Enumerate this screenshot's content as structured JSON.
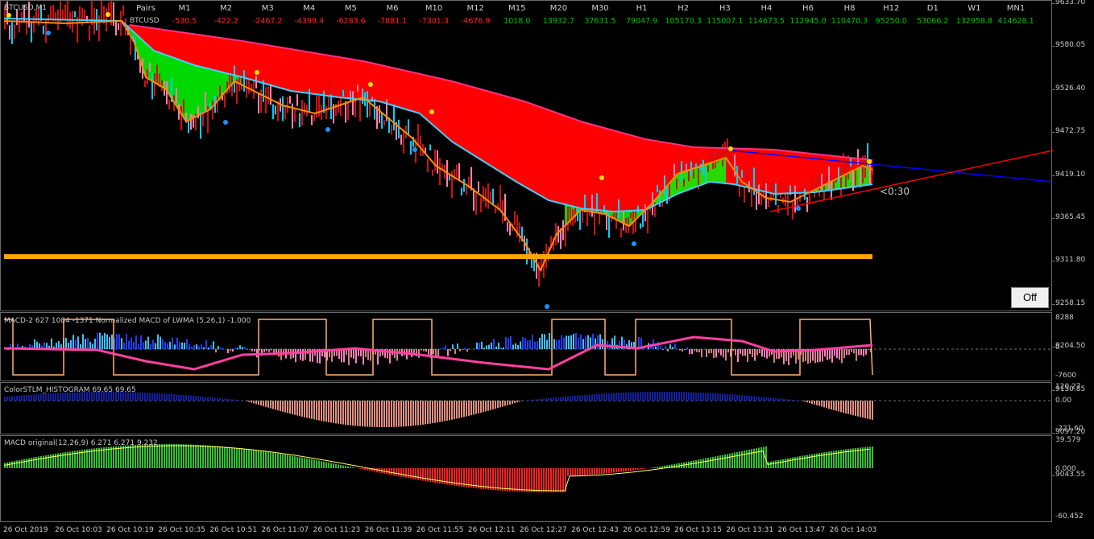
{
  "symbol_label": "BTCUSD,M1",
  "pair_name": "BTCUSD",
  "pairs_header": "Pairs",
  "timeframes": [
    {
      "name": "M1",
      "value": "-530.5",
      "sign": "neg"
    },
    {
      "name": "M2",
      "value": "-422.2",
      "sign": "neg"
    },
    {
      "name": "M3",
      "value": "-2467.2",
      "sign": "neg"
    },
    {
      "name": "M4",
      "value": "-4399.4",
      "sign": "neg"
    },
    {
      "name": "M5",
      "value": "-6283.6",
      "sign": "neg"
    },
    {
      "name": "M6",
      "value": "-7881.1",
      "sign": "neg"
    },
    {
      "name": "M10",
      "value": "-7301.3",
      "sign": "neg"
    },
    {
      "name": "M12",
      "value": "-4676.9",
      "sign": "neg"
    },
    {
      "name": "M15",
      "value": "1018.0",
      "sign": "pos"
    },
    {
      "name": "M20",
      "value": "13932.7",
      "sign": "pos"
    },
    {
      "name": "M30",
      "value": "37631.5",
      "sign": "pos"
    },
    {
      "name": "H1",
      "value": "79047.9",
      "sign": "pos"
    },
    {
      "name": "H2",
      "value": "105170.3",
      "sign": "pos"
    },
    {
      "name": "H3",
      "value": "115007.1",
      "sign": "pos"
    },
    {
      "name": "H4",
      "value": "114673.5",
      "sign": "pos"
    },
    {
      "name": "H6",
      "value": "112945.0",
      "sign": "pos"
    },
    {
      "name": "H8",
      "value": "110470.3",
      "sign": "pos"
    },
    {
      "name": "H12",
      "value": "95250.0",
      "sign": "pos"
    },
    {
      "name": "D1",
      "value": "53066.2",
      "sign": "pos"
    },
    {
      "name": "W1",
      "value": "132958.8",
      "sign": "pos"
    },
    {
      "name": "MN1",
      "value": "414628.1",
      "sign": "pos"
    }
  ],
  "price_axis": [
    "9633.70",
    "9580.05",
    "9526.40",
    "9472.75",
    "9419.10",
    "9365.45",
    "9311.80",
    "9258.15",
    "9204.50",
    "9150.85",
    "9097.20",
    "9043.55"
  ],
  "timer": "<0:30",
  "off_button": "Off",
  "indicators": {
    "macd2": {
      "title": "MACD-2 627 1084 -1371 Normalized MACD of LWMA (5,26,1) -1.000",
      "axis": [
        "8288",
        "0",
        "-7600"
      ]
    },
    "stlm": {
      "title": "ColorSTLM_HISTOGRAM 69.65 69.65",
      "axis": [
        "120.27",
        "0.00",
        "-221.60"
      ]
    },
    "macd": {
      "title": "MACD original(12,26,9) 6.271 6.271 9.232",
      "axis": [
        "39.579",
        "0.000",
        "-60.452"
      ]
    }
  },
  "time_axis": [
    "26 Oct 2019",
    "26 Oct 10:03",
    "26 Oct 10:19",
    "26 Oct 10:35",
    "26 Oct 10:51",
    "26 Oct 11:07",
    "26 Oct 11:23",
    "26 Oct 11:39",
    "26 Oct 11:55",
    "26 Oct 12:11",
    "26 Oct 12:27",
    "26 Oct 12:43",
    "26 Oct 12:59",
    "26 Oct 13:15",
    "26 Oct 13:31",
    "26 Oct 13:47",
    "26 Oct 14:03"
  ],
  "colors": {
    "bg": "#000000",
    "cloud_bear": "#ff0000",
    "cloud_bull": "#00ff00",
    "support": "#ffa500",
    "trend_blue": "#0000ff",
    "trend_red": "#ff0000",
    "macd_bear": "#ff2020",
    "macd_bull": "#30c030"
  }
}
